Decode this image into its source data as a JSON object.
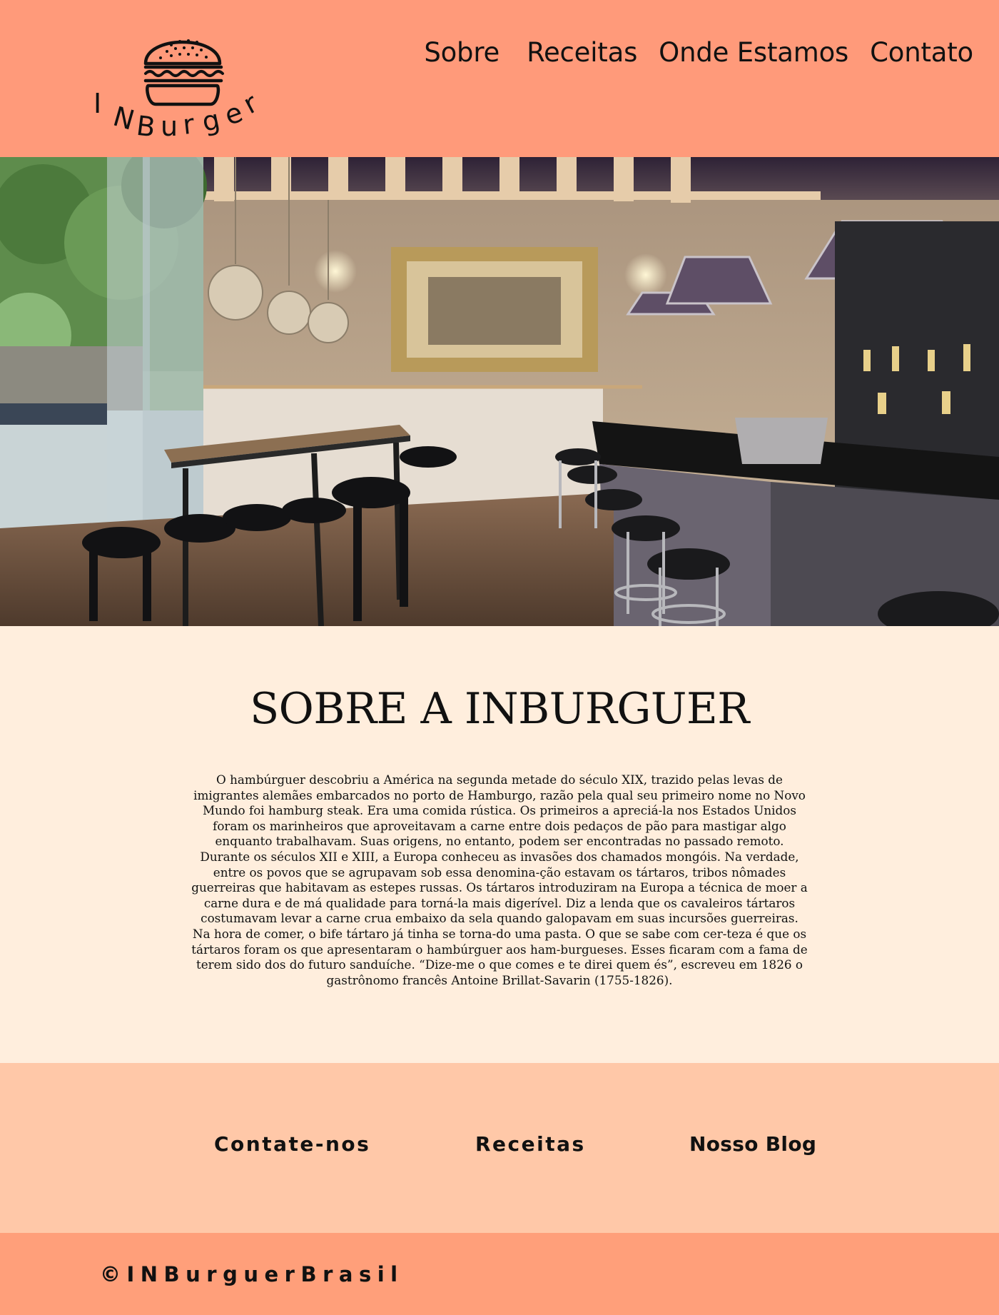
{
  "header": {
    "logo_text": "INBurger",
    "nav": [
      {
        "label": "Sobre"
      },
      {
        "label": "Receitas"
      },
      {
        "label": "Onde Estamos"
      },
      {
        "label": "Contato"
      }
    ]
  },
  "about": {
    "title": "SOBRE A INBURGUER",
    "body": "O hambúrguer descobriu a América na segunda metade do século XIX, trazido pelas levas de imigrantes alemães embarcados no porto de Hamburgo, razão pela qual seu primeiro nome no Novo Mundo foi hamburg steak. Era uma comida rústica. Os primeiros a apreciá-la nos Estados Unidos foram os marinheiros que aproveitavam a carne entre dois pedaços de pão para mastigar algo enquanto trabalhavam. Suas origens, no entanto, podem ser encontradas no passado remoto. Durante os séculos XII e XIII, a Europa conheceu as invasões dos chamados mongóis. Na verdade, entre os povos que se agrupavam sob essa denomina-ção estavam os tártaros, tribos nômades guerreiras que habitavam as estepes russas. Os tártaros introduziram na Europa a técnica de moer a carne dura e de má qualidade para torná-la mais digerível. Diz a lenda que os cavaleiros tártaros costumavam levar a carne crua embaixo da sela quando galopavam em suas incursões guerreiras. Na hora de comer, o bife tártaro já tinha se torna-do uma pasta. O que se sabe com cer-teza é que os tártaros foram os que apresentaram o hambúrguer aos ham-burgueses. Esses ficaram com a fama de terem sido dos do futuro sanduíche. “Dize-me o que comes e te direi quem és”, escreveu em 1826 o gastrônomo francês Antoine Brillat-Savarin (1755-1826)."
  },
  "footer_links": {
    "contact": "Contate-nos",
    "recipes": "Receitas",
    "blog": "Nosso Blog"
  },
  "copyright": "©INBurguerBrasil",
  "colors": {
    "header_bg": "#ff9a7a",
    "about_bg": "#ffeedd",
    "links_bg": "#ffc8a8",
    "bottom_bg": "#ff9f7a"
  },
  "icons": [
    "burger-logo-icon"
  ]
}
